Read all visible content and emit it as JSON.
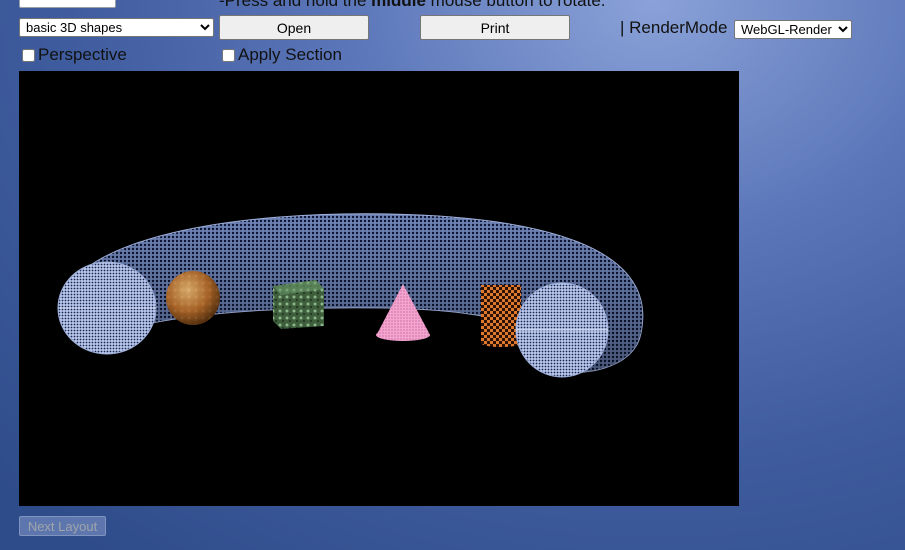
{
  "toolbar": {
    "hint_prefix": "-Press and hold the ",
    "hint_bold": "middle",
    "hint_suffix": " mouse button to rotate.",
    "scene_select": {
      "value": "basic 3D shapes"
    },
    "open_label": "Open",
    "print_label": "Print",
    "render_label": "| RenderMode",
    "render_select": {
      "value": "WebGL-Render"
    },
    "perspective_label": "Perspective",
    "apply_section_label": "Apply Section"
  },
  "viewport": {
    "background": "#000000"
  },
  "footer": {
    "next_layout_label": "Next Layout"
  }
}
